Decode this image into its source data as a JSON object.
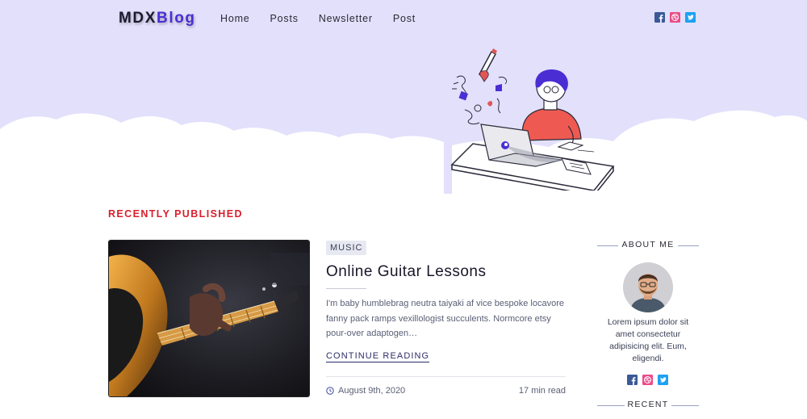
{
  "brand": {
    "logo_part1": "MDX",
    "logo_part2": "Blog"
  },
  "nav": {
    "links": [
      "Home",
      "Posts",
      "Newsletter",
      "Post"
    ]
  },
  "header_social": [
    "facebook-icon",
    "dribbble-icon",
    "twitter-icon"
  ],
  "section": {
    "title": "RECENTLY PUBLISHED"
  },
  "post": {
    "tag": "MUSIC",
    "title": "Online Guitar Lessons",
    "excerpt": "I'm baby humblebrag neutra taiyaki af vice bespoke locavore fanny pack ramps vexillologist succulents. Normcore etsy pour-over adaptogen…",
    "read_more": "CONTINUE READING",
    "date": "August 9th, 2020",
    "read_time": "17 min read"
  },
  "sidebar": {
    "about_heading": "ABOUT ME",
    "about_text": "Lorem ipsum dolor sit amet consectetur adipisicing elit. Eum, eligendi.",
    "recent_heading": "RECENT"
  },
  "colors": {
    "hero_bg": "#e2e0fb",
    "accent_red": "#d8202d",
    "brand_purple": "#4b2dd4",
    "facebook": "#3b5998",
    "dribbble": "#ea4c89",
    "twitter": "#1da1f2"
  }
}
